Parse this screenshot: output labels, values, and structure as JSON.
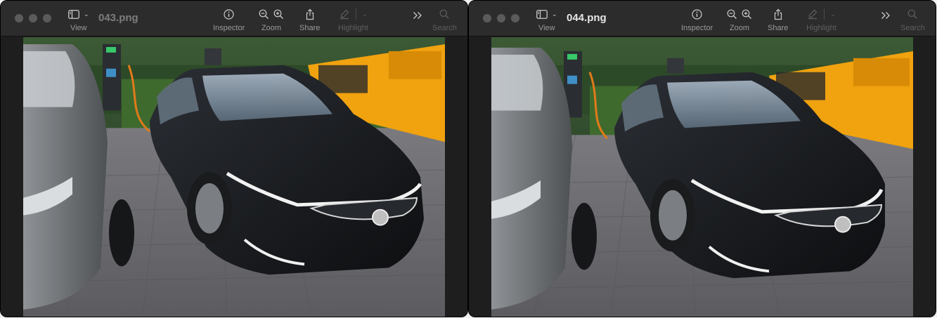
{
  "windows": [
    {
      "title": "043.png",
      "toolbar": {
        "view_label": "View",
        "inspector_label": "Inspector",
        "zoom_label": "Zoom",
        "share_label": "Share",
        "highlight_label": "Highlight",
        "search_label": "Search"
      }
    },
    {
      "title": "044.png",
      "toolbar": {
        "view_label": "View",
        "inspector_label": "Inspector",
        "zoom_label": "Zoom",
        "share_label": "Share",
        "highlight_label": "Highlight",
        "search_label": "Search"
      }
    }
  ],
  "colors": {
    "window_bg": "#1e1e1e",
    "toolbar_bg": "#2c2c2c",
    "traffic_light_inactive": "#5b5b5b",
    "truck": "#f0a20f",
    "car_body": "#17191c",
    "pavement": "#6c6c70"
  },
  "icons": [
    "sidebar-icon",
    "info-icon",
    "zoom-out-icon",
    "zoom-in-icon",
    "share-icon",
    "highlight-pen-icon",
    "chevron-down-icon",
    "more-icon",
    "search-icon"
  ]
}
